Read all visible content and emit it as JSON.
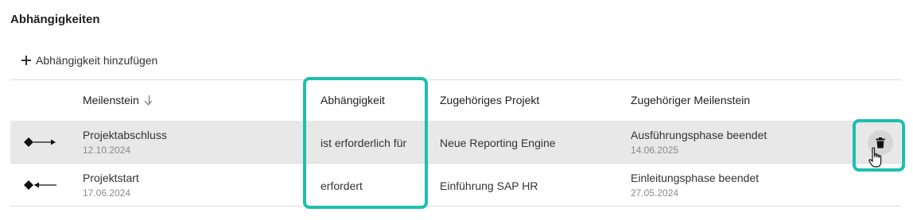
{
  "section": {
    "title": "Abhängigkeiten",
    "add_label": "Abhängigkeit hinzufügen"
  },
  "table": {
    "columns": {
      "milestone": "Meilenstein",
      "dependency": "Abhängigkeit",
      "project": "Zugehöriges Projekt",
      "related_milestone": "Zugehöriger Meilenstein"
    },
    "sort": {
      "column": "milestone",
      "direction": "descending"
    },
    "rows": [
      {
        "direction_icon": "arrow-right-icon",
        "milestone": "Projektabschluss",
        "milestone_date": "12.10.2024",
        "dependency": "ist erforderlich für",
        "project": "Neue Reporting Engine",
        "related_milestone": "Ausführungsphase beendet",
        "related_date": "14.06.2025",
        "hovered": true
      },
      {
        "direction_icon": "arrow-left-icon",
        "milestone": "Projektstart",
        "milestone_date": "17.06.2024",
        "dependency": "erfordert",
        "project": "Einführung SAP HR",
        "related_milestone": "Einleitungsphase beendet",
        "related_date": "27.05.2024",
        "hovered": false
      }
    ]
  },
  "colors": {
    "highlight": "#1dbfae",
    "row_hover": "#e8e8e8",
    "divider": "#dcdcdc"
  },
  "icons": {
    "add": "plus-icon",
    "sort": "arrow-down-icon",
    "delete": "trash-icon",
    "cursor": "hand-pointer-icon"
  }
}
